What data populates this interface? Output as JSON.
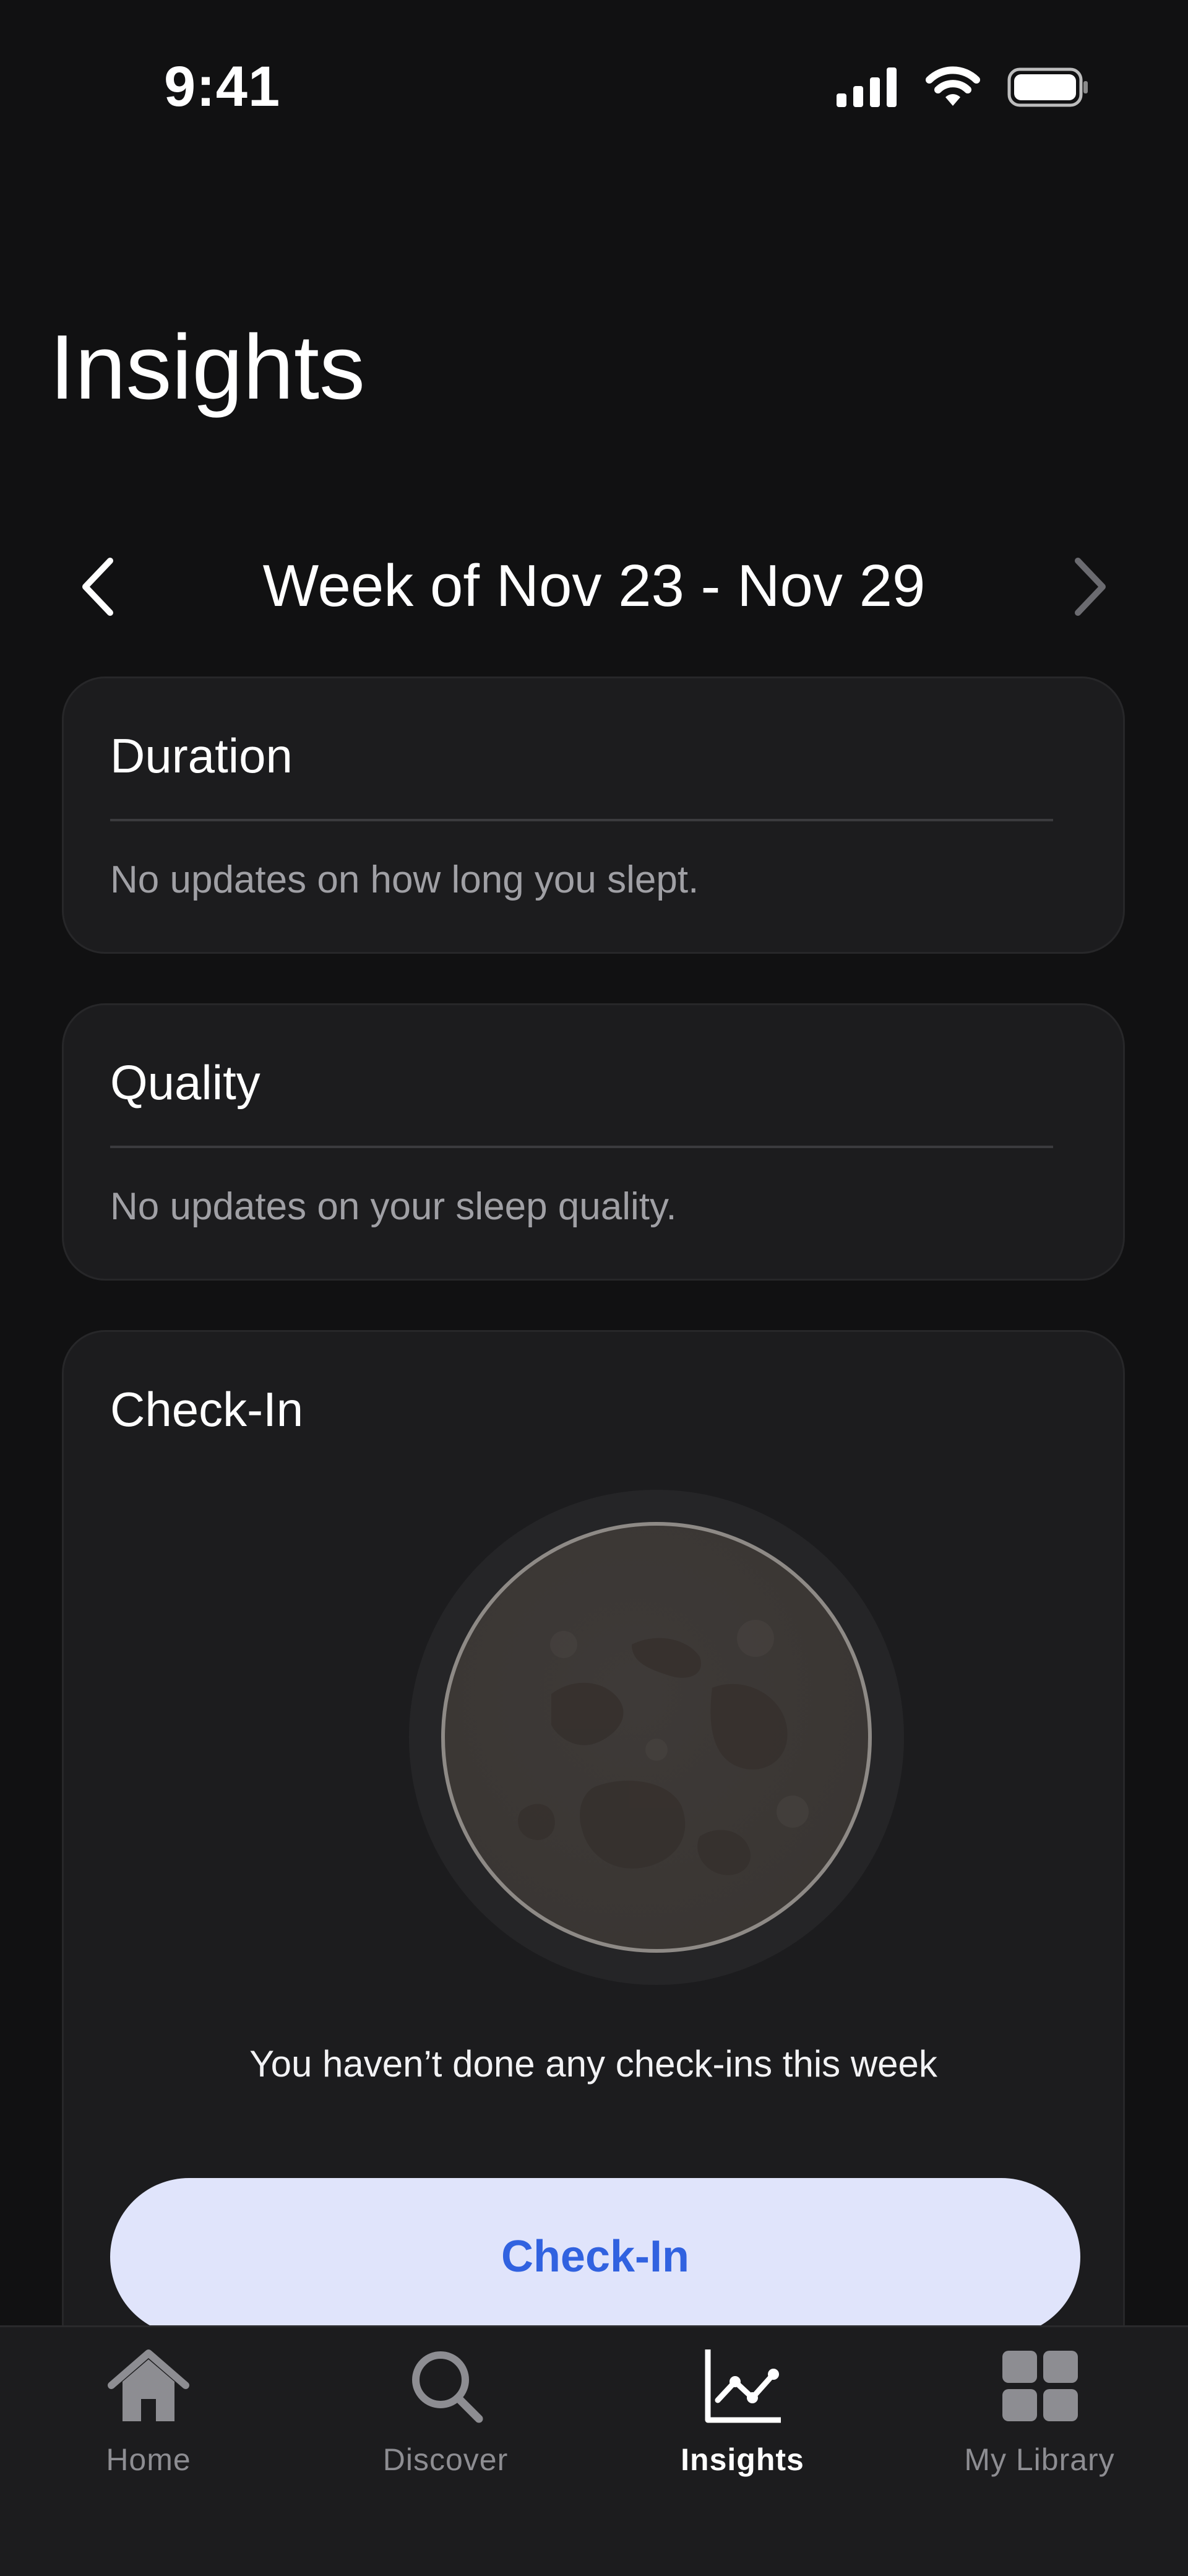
{
  "status_bar": {
    "time": "9:41"
  },
  "page": {
    "title": "Insights"
  },
  "week_nav": {
    "label": "Week of Nov 23 - Nov 29"
  },
  "cards": {
    "duration": {
      "title": "Duration",
      "body": "No updates on how long you slept."
    },
    "quality": {
      "title": "Quality",
      "body": "No updates on your sleep quality."
    },
    "checkin": {
      "title": "Check-In",
      "caption": "You haven’t done any check-ins this week",
      "button_label": "Check-In"
    }
  },
  "tab_bar": {
    "active": "Insights",
    "tabs": [
      {
        "label": "Home",
        "icon": "home-icon"
      },
      {
        "label": "Discover",
        "icon": "search-icon"
      },
      {
        "label": "Insights",
        "icon": "chart-icon"
      },
      {
        "label": "My Library",
        "icon": "grid-icon"
      }
    ]
  },
  "colors": {
    "background": "#111112",
    "card": "#1c1c1e",
    "button_bg": "#e0e4fb",
    "accent": "#3162e0",
    "muted_text": "#a0a0a5",
    "inactive_tab": "#8d8d92"
  }
}
